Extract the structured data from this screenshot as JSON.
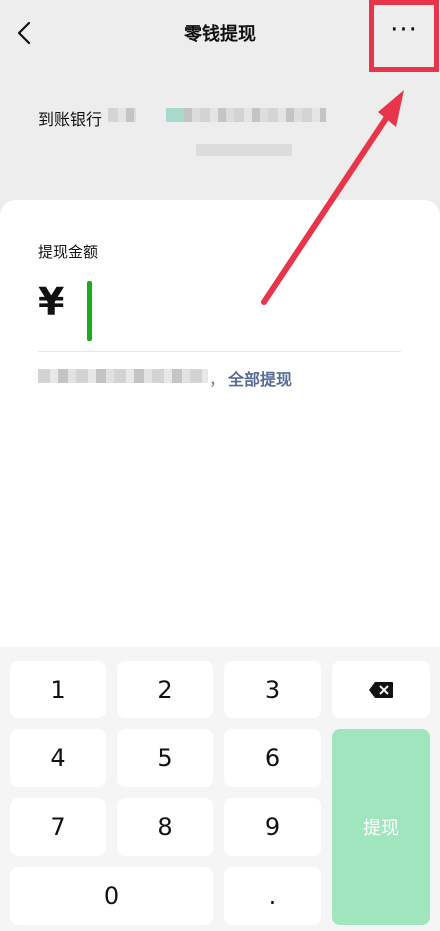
{
  "header": {
    "title": "零钱提现",
    "back_icon": "chevron-left-icon",
    "more_label": "···"
  },
  "bank": {
    "label": "到账银行"
  },
  "amount": {
    "label": "提现金额",
    "currency_symbol": "¥",
    "value": ""
  },
  "balance": {
    "suffix": "，",
    "withdraw_all_label": "全部提现"
  },
  "keypad": {
    "keys": [
      "1",
      "2",
      "3",
      "4",
      "5",
      "6",
      "7",
      "8",
      "9",
      "0",
      "."
    ],
    "submit_label": "提现",
    "delete_icon": "backspace-icon"
  },
  "colors": {
    "accent_link": "#576b95",
    "cursor": "#1aad19",
    "submit_disabled": "#9fe6bf",
    "annotation": "#e8354b"
  }
}
